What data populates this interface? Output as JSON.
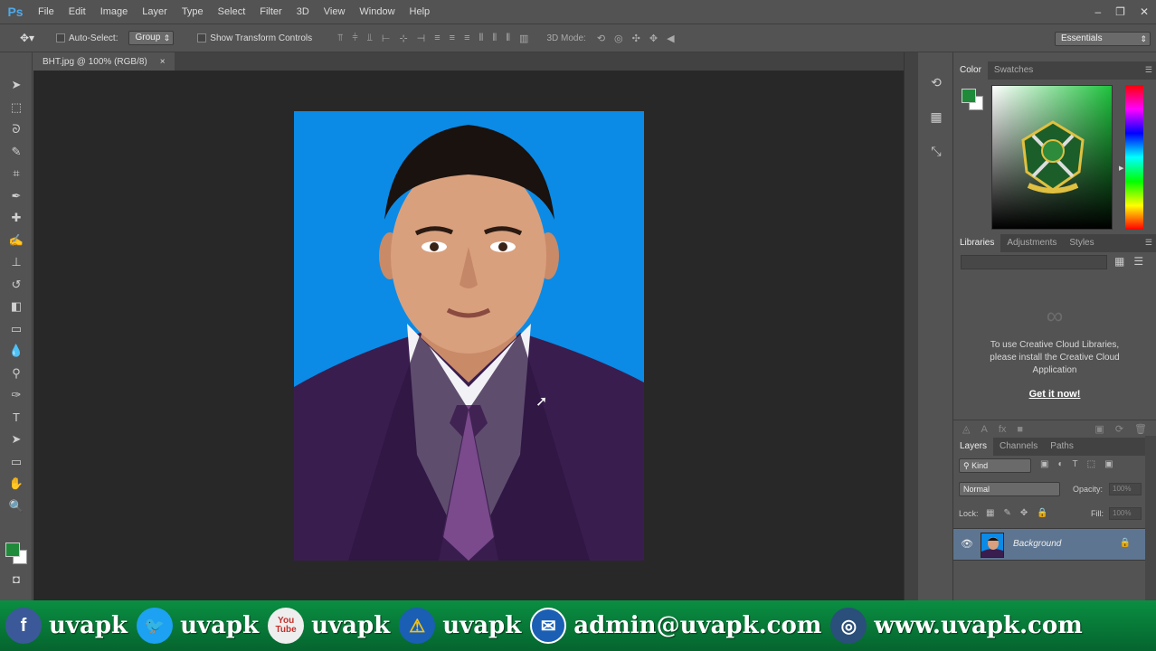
{
  "app": {
    "logo": "Ps",
    "menu": [
      "File",
      "Edit",
      "Image",
      "Layer",
      "Type",
      "Select",
      "Filter",
      "3D",
      "View",
      "Window",
      "Help"
    ],
    "window_controls": {
      "minimize": "–",
      "restore": "❐",
      "close": "✕"
    }
  },
  "options_bar": {
    "auto_select_label": "Auto-Select:",
    "auto_select_value": "Group",
    "show_transform_label": "Show Transform Controls",
    "mode_3d_label": "3D Mode:",
    "workspace": "Essentials"
  },
  "document": {
    "tab_title": "BHT.jpg @ 100% (RGB/8)",
    "tab_close": "×"
  },
  "tools": [
    "move-tool",
    "marquee-tool",
    "lasso-tool",
    "quick-select-tool",
    "crop-tool",
    "eyedropper-tool",
    "healing-brush-tool",
    "brush-tool",
    "clone-stamp-tool",
    "history-brush-tool",
    "eraser-tool",
    "gradient-tool",
    "blur-tool",
    "dodge-tool",
    "pen-tool",
    "type-tool",
    "path-select-tool",
    "rectangle-tool",
    "hand-tool",
    "zoom-tool"
  ],
  "color_panel": {
    "tabs": [
      "Color",
      "Swatches"
    ],
    "foreground": "#1f8a3a",
    "background": "#ffffff"
  },
  "libraries_panel": {
    "tabs": [
      "Libraries",
      "Adjustments",
      "Styles"
    ],
    "message": "To use Creative Cloud Libraries, please install the Creative Cloud Application",
    "link": "Get it now!"
  },
  "layers_panel": {
    "tabs": [
      "Layers",
      "Channels",
      "Paths"
    ],
    "filter": "Kind",
    "blend_mode": "Normal",
    "opacity_label": "Opacity:",
    "opacity_value": "100%",
    "lock_label": "Lock:",
    "fill_label": "Fill:",
    "fill_value": "100%",
    "layers": [
      {
        "name": "Background",
        "visible": true,
        "locked": true
      }
    ]
  },
  "banner": {
    "items": [
      {
        "icon": "facebook-icon",
        "glyph": "f",
        "color": "#3b5998",
        "text": "uvapk"
      },
      {
        "icon": "twitter-icon",
        "glyph": "🐦",
        "color": "#1da1f2",
        "text": "uvapk"
      },
      {
        "icon": "youtube-icon",
        "glyph": "You\nTube",
        "color": "#eeeeee",
        "text": "uvapk"
      },
      {
        "icon": "warning-icon",
        "glyph": "⚠",
        "color": "#1a5fb4",
        "text": "uvapk"
      },
      {
        "icon": "email-icon",
        "glyph": "✉",
        "color": "#1a5fb4",
        "text": "admin@uvapk.com"
      },
      {
        "icon": "globe-icon",
        "glyph": "◎",
        "color": "#2a4f7a",
        "text": "www.uvapk.com"
      }
    ]
  }
}
